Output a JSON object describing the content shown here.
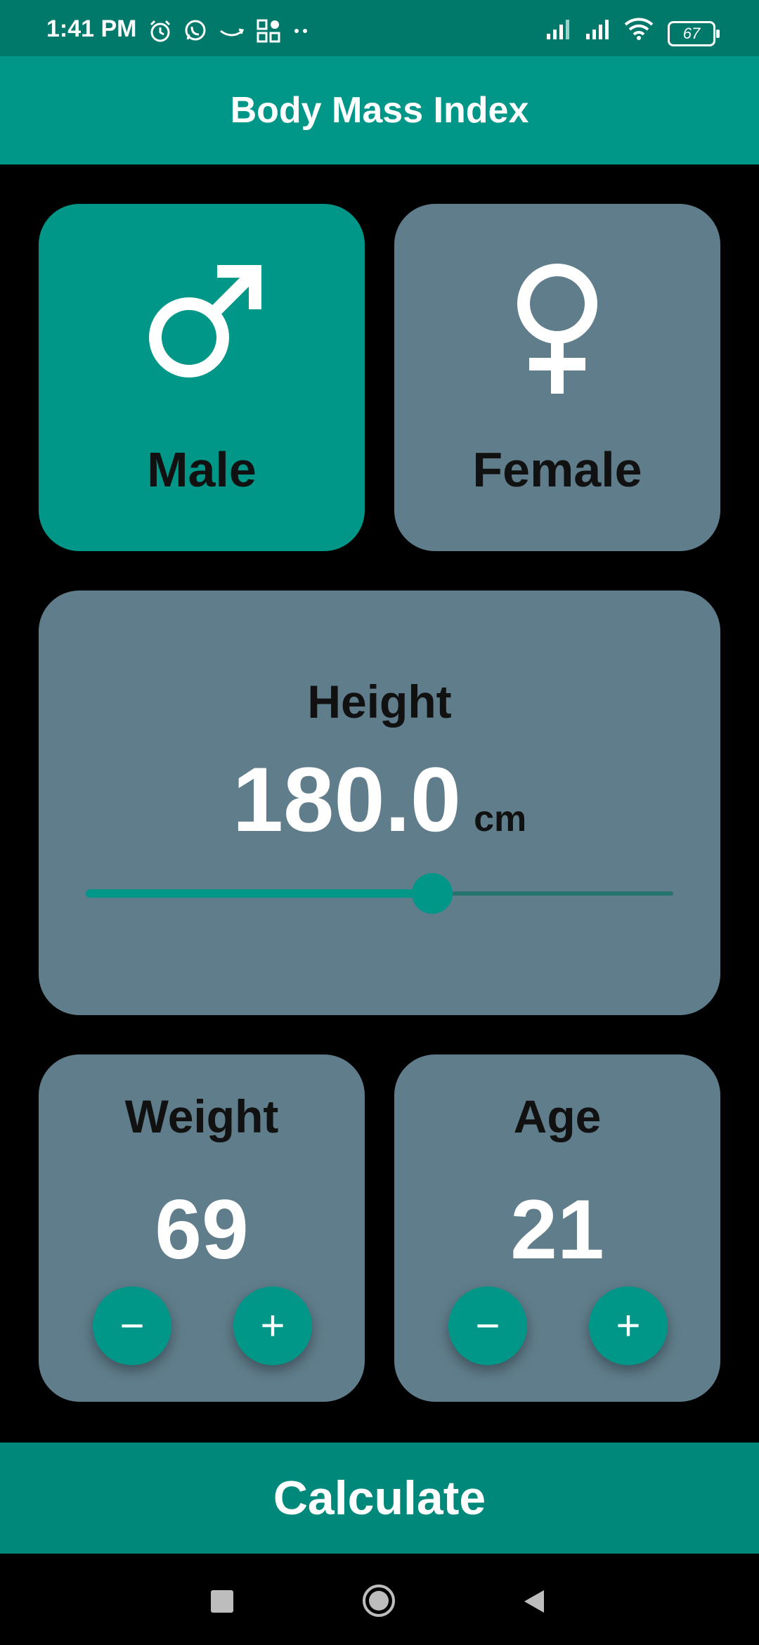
{
  "status_bar": {
    "time": "1:41 PM",
    "battery": "67",
    "left_icons": [
      "alarm-icon",
      "whatsapp-icon",
      "amazon-icon",
      "grid-icon",
      "dots-icon"
    ],
    "right_icons": [
      "signal-icon",
      "signal-icon",
      "wifi-icon",
      "battery-icon"
    ]
  },
  "app_bar": {
    "title": "Body Mass Index"
  },
  "gender": {
    "male_label": "Male",
    "female_label": "Female",
    "selected": "Male"
  },
  "height": {
    "title": "Height",
    "value": "180.0",
    "unit": "cm",
    "slider_fraction": 0.59
  },
  "weight": {
    "title": "Weight",
    "value": "69",
    "minus_label": "−",
    "plus_label": "+"
  },
  "age": {
    "title": "Age",
    "value": "21",
    "minus_label": "−",
    "plus_label": "+"
  },
  "calculate_label": "Calculate",
  "colors": {
    "primary": "#009688",
    "card": "#607d8b",
    "background": "#000000"
  }
}
